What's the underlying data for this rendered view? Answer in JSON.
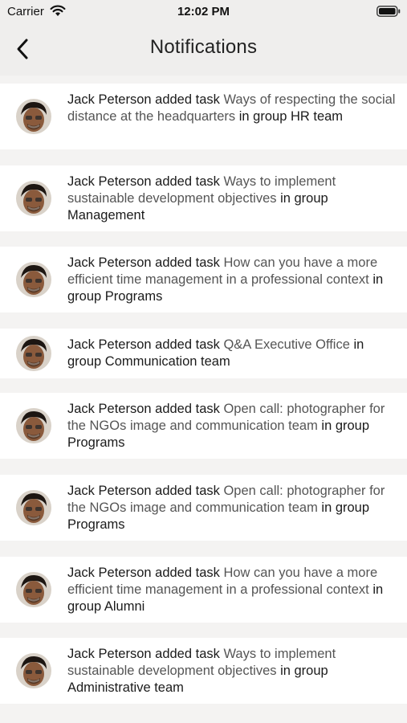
{
  "status_bar": {
    "carrier": "Carrier",
    "time": "12:02 PM"
  },
  "nav": {
    "title": "Notifications",
    "back_icon": "chevron-left-icon"
  },
  "notifications": [
    {
      "actor": "Jack Peterson",
      "action": " added task ",
      "task": "Ways of respecting the social distance at the headquarters",
      "group_prefix": " in group ",
      "group": "HR team"
    },
    {
      "actor": "Jack Peterson",
      "action": " added task ",
      "task": "Ways to implement sustainable development objectives",
      "group_prefix": " in group ",
      "group": "Management"
    },
    {
      "actor": "Jack Peterson",
      "action": " added task ",
      "task": "How can you have a more efficient time management in a professional context",
      "group_prefix": " in group ",
      "group": "Programs"
    },
    {
      "actor": "Jack Peterson",
      "action": " added task ",
      "task": "Q&A Executive Office",
      "group_prefix": " in group ",
      "group": "Communication team"
    },
    {
      "actor": "Jack Peterson",
      "action": " added task ",
      "task": "Open call: photographer for the NGOs image and communication team",
      "group_prefix": " in group ",
      "group": "Programs"
    },
    {
      "actor": "Jack Peterson",
      "action": " added task ",
      "task": "Open call: photographer for the NGOs image and communication team",
      "group_prefix": " in group ",
      "group": "Programs"
    },
    {
      "actor": "Jack Peterson",
      "action": " added task ",
      "task": "How can you have a more efficient time management in a professional context",
      "group_prefix": " in group ",
      "group": "Alumni"
    },
    {
      "actor": "Jack Peterson",
      "action": " added task ",
      "task": "Ways to implement sustainable development objectives",
      "group_prefix": " in group ",
      "group": "Administrative team"
    }
  ],
  "colors": {
    "background": "#f4f3f2",
    "card": "#ffffff",
    "bold_text": "#1b1b1b",
    "regular_text": "#555555"
  }
}
